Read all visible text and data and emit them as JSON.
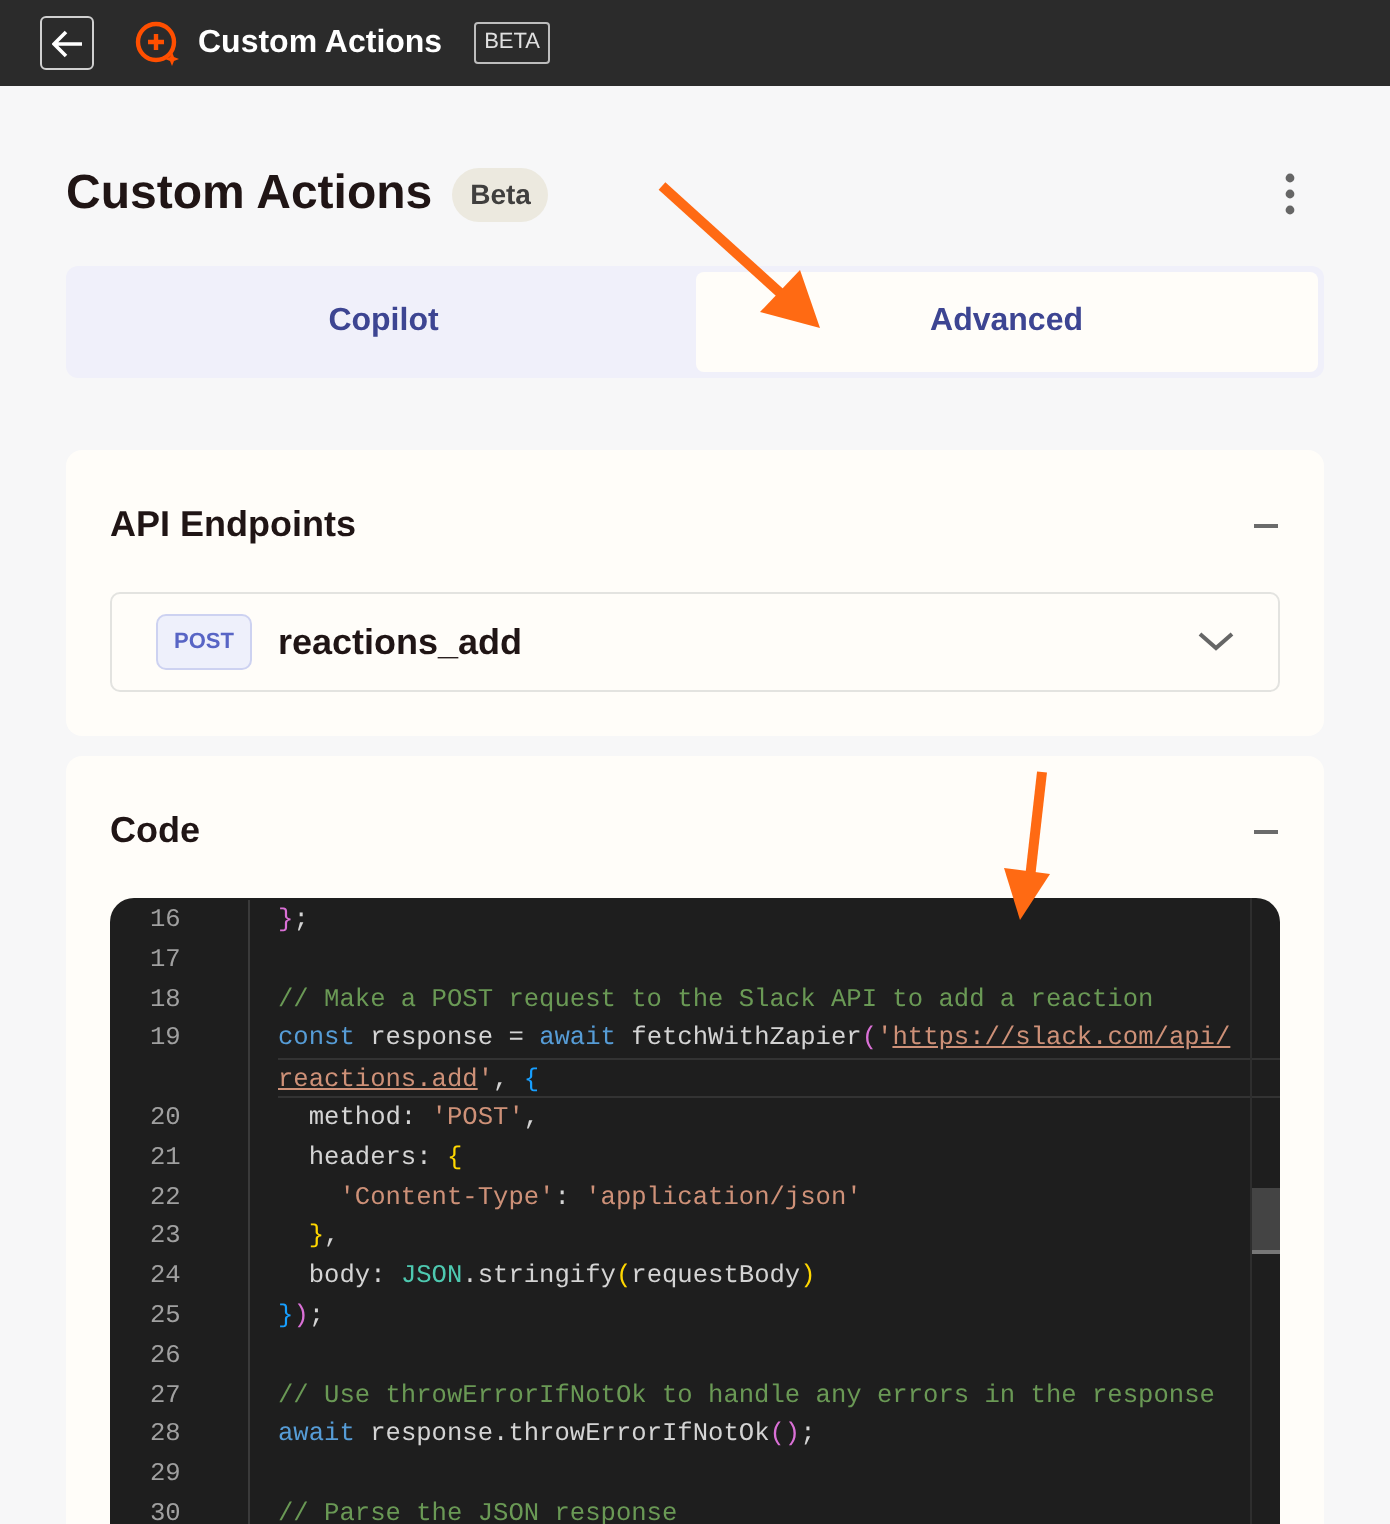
{
  "topbar": {
    "title": "Custom Actions",
    "badge": "BETA"
  },
  "header": {
    "title": "Custom Actions",
    "badge": "Beta"
  },
  "tabs": [
    {
      "label": "Copilot",
      "selected": false
    },
    {
      "label": "Advanced",
      "selected": true
    }
  ],
  "endpoints": {
    "title": "API Endpoints",
    "expanded": true,
    "items": [
      {
        "method": "POST",
        "name": "reactions_add",
        "expanded": false
      }
    ]
  },
  "code": {
    "title": "Code",
    "expanded": true,
    "lines": [
      {
        "number": "16",
        "tokens": [
          {
            "text": "}",
            "kind": "bracket1"
          },
          {
            "text": ";",
            "kind": "plain"
          }
        ]
      },
      {
        "number": "17"
      },
      {
        "number": "18",
        "tokens": [
          {
            "text": "// Make a POST request to the Slack API to add a reaction",
            "kind": "comment"
          }
        ]
      },
      {
        "number": "19",
        "tokens": [
          {
            "text": "const",
            "kind": "keyword"
          },
          {
            "text": " response = ",
            "kind": "plain"
          },
          {
            "text": "await",
            "kind": "keyword"
          },
          {
            "text": " fetchWithZapier",
            "kind": "plain"
          },
          {
            "text": "(",
            "kind": "bracket1"
          },
          {
            "text": "'",
            "kind": "string"
          },
          {
            "text": "https://slack.com/api/",
            "kind": "link"
          }
        ]
      },
      {
        "tokens": [
          {
            "text": "reactions.add",
            "kind": "link"
          },
          {
            "text": "'",
            "kind": "string"
          },
          {
            "text": ", ",
            "kind": "plain"
          },
          {
            "text": "{",
            "kind": "bracket3"
          }
        ]
      },
      {
        "number": "20",
        "tokens": [
          {
            "text": "  method: ",
            "kind": "plain"
          },
          {
            "text": "'POST'",
            "kind": "string"
          },
          {
            "text": ",",
            "kind": "plain"
          }
        ]
      },
      {
        "number": "21",
        "tokens": [
          {
            "text": "  headers: ",
            "kind": "plain"
          },
          {
            "text": "{",
            "kind": "bracket2"
          }
        ]
      },
      {
        "number": "22",
        "tokens": [
          {
            "text": "    'Content-Type'",
            "kind": "string"
          },
          {
            "text": ": ",
            "kind": "plain"
          },
          {
            "text": "'application/json'",
            "kind": "string"
          }
        ]
      },
      {
        "number": "23",
        "tokens": [
          {
            "text": "  }",
            "kind": "bracket2"
          },
          {
            "text": ",",
            "kind": "plain"
          }
        ]
      },
      {
        "number": "24",
        "tokens": [
          {
            "text": "  body: ",
            "kind": "plain"
          },
          {
            "text": "JSON",
            "kind": "builtin"
          },
          {
            "text": ".stringify",
            "kind": "plain"
          },
          {
            "text": "(",
            "kind": "bracket2"
          },
          {
            "text": "requestBody",
            "kind": "plain"
          },
          {
            "text": ")",
            "kind": "bracket2"
          }
        ]
      },
      {
        "number": "25",
        "tokens": [
          {
            "text": "}",
            "kind": "bracket3"
          },
          {
            "text": ")",
            "kind": "bracket1"
          },
          {
            "text": ";",
            "kind": "plain"
          }
        ]
      },
      {
        "number": "26"
      },
      {
        "number": "27",
        "tokens": [
          {
            "text": "// Use throwErrorIfNotOk to handle any errors in the response",
            "kind": "comment"
          }
        ]
      },
      {
        "number": "28",
        "tokens": [
          {
            "text": "await",
            "kind": "keyword"
          },
          {
            "text": " response.throwErrorIfNotOk",
            "kind": "plain"
          },
          {
            "text": "()",
            "kind": "bracket1"
          },
          {
            "text": ";",
            "kind": "plain"
          }
        ]
      },
      {
        "number": "29"
      },
      {
        "number": "30",
        "tokens": [
          {
            "text": "// Parse the JSON response",
            "kind": "comment"
          }
        ]
      }
    ]
  }
}
